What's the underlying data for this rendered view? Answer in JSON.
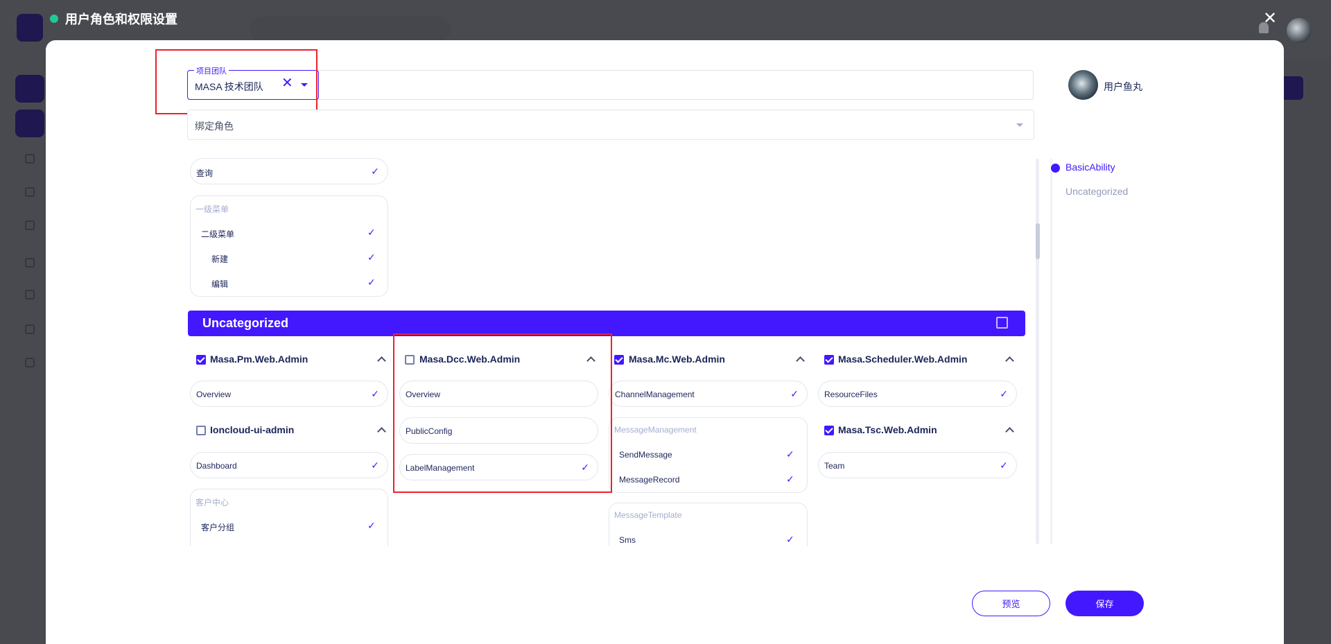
{
  "background": {
    "brand_color": "#4318ff"
  },
  "dialog": {
    "title": "用户角色和权限设置",
    "status_color": "#20c997",
    "close_icon": "close-icon"
  },
  "team_select": {
    "label": "项目团队",
    "value": "MASA 技术团队"
  },
  "role_select": {
    "placeholder": "绑定角色"
  },
  "user": {
    "name": "用户鱼丸"
  },
  "anchors": [
    {
      "label": "BasicAbility",
      "active": true
    },
    {
      "label": "Uncategorized",
      "active": false
    }
  ],
  "basic": {
    "chip": {
      "label": "查询",
      "checked": true
    },
    "group": {
      "title": "一级菜单",
      "items": [
        {
          "label": "二级菜单",
          "checked": true
        },
        {
          "label": "新建",
          "checked": true
        },
        {
          "label": "编辑",
          "checked": true
        }
      ]
    }
  },
  "uncategorized": {
    "title": "Uncategorized",
    "checked": false
  },
  "apps": {
    "pm": {
      "name": "Masa.Pm.Web.Admin",
      "checked": true,
      "items": [
        {
          "label": "Overview",
          "checked": true
        }
      ]
    },
    "ioncloud": {
      "name": "Ioncloud-ui-admin",
      "checked": false,
      "items": [
        {
          "label": "Dashboard",
          "checked": true
        }
      ],
      "group": {
        "title": "客户中心",
        "items": [
          {
            "label": "客户分组",
            "checked": true
          }
        ]
      }
    },
    "dcc": {
      "name": "Masa.Dcc.Web.Admin",
      "checked": false,
      "items": [
        {
          "label": "Overview",
          "checked": false
        },
        {
          "label": "PublicConfig",
          "checked": false
        },
        {
          "label": "LabelManagement",
          "checked": true
        }
      ]
    },
    "mc": {
      "name": "Masa.Mc.Web.Admin",
      "checked": true,
      "items": [
        {
          "label": "ChannelManagement",
          "checked": true
        }
      ],
      "group1": {
        "title": "MessageManagement",
        "items": [
          {
            "label": "SendMessage",
            "checked": true
          },
          {
            "label": "MessageRecord",
            "checked": true
          }
        ]
      },
      "group2": {
        "title": "MessageTemplate",
        "items": [
          {
            "label": "Sms",
            "checked": true
          }
        ]
      }
    },
    "scheduler": {
      "name": "Masa.Scheduler.Web.Admin",
      "checked": true,
      "items": [
        {
          "label": "ResourceFiles",
          "checked": true
        }
      ]
    },
    "tsc": {
      "name": "Masa.Tsc.Web.Admin",
      "checked": true,
      "items": [
        {
          "label": "Team",
          "checked": true
        }
      ]
    }
  },
  "buttons": {
    "preview": "预览",
    "save": "保存"
  }
}
